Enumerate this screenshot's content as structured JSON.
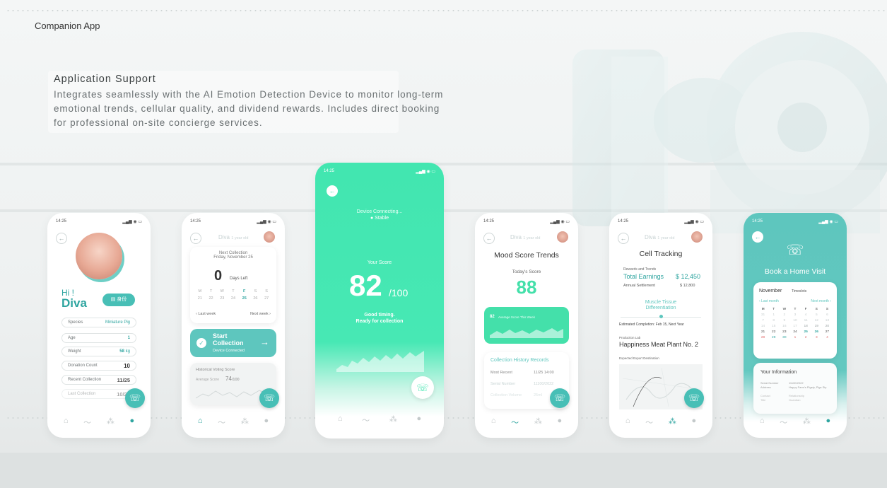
{
  "page": {
    "title": "Companion App"
  },
  "support": {
    "title": "Application Support",
    "line1": "Integrates seamlessly with the AI Emotion Detection Device to monitor long-term",
    "line2": "emotional trends, cellular quality, and dividend rewards. Includes direct booking",
    "line3": "for professional on-site concierge services."
  },
  "status_time": "14:25",
  "signal_icons": "▂▄▆ ◉ ▭",
  "nav_icons": [
    "home-icon",
    "trend-icon",
    "cell-icon",
    "profile-icon"
  ],
  "nav_glyphs": [
    "⌂",
    "〜",
    "⁂",
    "●"
  ],
  "colors": {
    "teal": "#2fa5a0",
    "mint": "#44e8b2",
    "aqua": "#5ec6be"
  },
  "profile": {
    "greeting": "Hi !",
    "name": "Diva",
    "id_badge": "身份",
    "fields": [
      {
        "label": "Species",
        "value": "Miniature Pig"
      },
      {
        "label": "Age",
        "value": "1"
      },
      {
        "label": "Weight",
        "value": "58",
        "unit": "kg"
      },
      {
        "label": "Donation Count",
        "value": "10"
      },
      {
        "label": "Recent Collection",
        "value": "11/25"
      },
      {
        "label": "Last Collection",
        "value": "10/25"
      }
    ]
  },
  "collection": {
    "header_name": "Diva",
    "header_age": "1 year old",
    "next_label": "Next Collection",
    "next_date": "Friday, November 25",
    "days": "0",
    "days_label": "Days Left",
    "weekdays": [
      "M",
      "T",
      "W",
      "T",
      "F",
      "S",
      "S"
    ],
    "dates": [
      "21",
      "22",
      "23",
      "24",
      "25",
      "26",
      "27"
    ],
    "last_week": "‹ Last week",
    "next_week": "Next week ›",
    "start_title": "Start",
    "start_title2": "Collection",
    "start_sub": "Device Connected",
    "hist_title": "Historical Voting Score",
    "hist_avg_label": "Average Score",
    "hist_avg": "74",
    "hist_avg_unit": "/100"
  },
  "score_screen": {
    "connecting": "Device Connecting...",
    "stable": "Stable",
    "your_score": "Your Score",
    "score": "82",
    "out_of": "/100",
    "msg1": "Good timing.",
    "msg2": "Ready for collection"
  },
  "mood": {
    "header_name": "Diva",
    "header_age": "1 year old",
    "title": "Mood Score Trends",
    "today_label": "Today's Score",
    "today": "88",
    "avg": "82",
    "avg_label": "Average Score This Week",
    "history_title": "Collection History Records",
    "rows": [
      {
        "k": "Most Recent",
        "v": "11/25 14:00"
      },
      {
        "k": "Serial Number",
        "v": "11100/2022"
      },
      {
        "k": "Collection Volume",
        "v": "25ml"
      }
    ]
  },
  "cell": {
    "header_name": "Diva",
    "header_age": "1 year old",
    "title": "Cell Tracking",
    "rewards_label": "Rewards and Trends",
    "earnings_label": "Total Earnings",
    "earnings": "$ 12,450",
    "annual_label": "Annual Settlement",
    "annual": "$ 12,800",
    "diff1": "Muscle Tissue",
    "diff2": "Differentiation",
    "completion": "Estimated Completion: Feb 15, Next Year",
    "lab_label": "Production Lab",
    "lab": "Happiness Meat Plant No. 2",
    "export_label": "Expected Export Destination"
  },
  "visit": {
    "title": "Book a Home Visit",
    "month": "November",
    "timeslots": "Timeslots",
    "last_month": "‹ Last month",
    "next_month": "Next month ›",
    "weekdays": [
      "M",
      "T",
      "W",
      "T",
      "F",
      "S",
      "S"
    ],
    "days": [
      "31",
      "1",
      "2",
      "3",
      "4",
      "5",
      "6",
      "7",
      "8",
      "9",
      "10",
      "11",
      "12",
      "13",
      "14",
      "15",
      "16",
      "17",
      "18",
      "19",
      "20",
      "21",
      "22",
      "23",
      "24",
      "25",
      "26",
      "27",
      "28",
      "29",
      "30",
      "1",
      "2",
      "3",
      "4"
    ],
    "info_title": "Your Information",
    "info_rows": [
      {
        "k": "Serial Number",
        "v": "11100/2022"
      },
      {
        "k": "Address",
        "v": "Happy Farm's Pigsty, Pigs Sty"
      },
      {
        "k": "Contact",
        "v": "Relationship"
      },
      {
        "k": "Title",
        "v": "Guardian"
      }
    ]
  }
}
